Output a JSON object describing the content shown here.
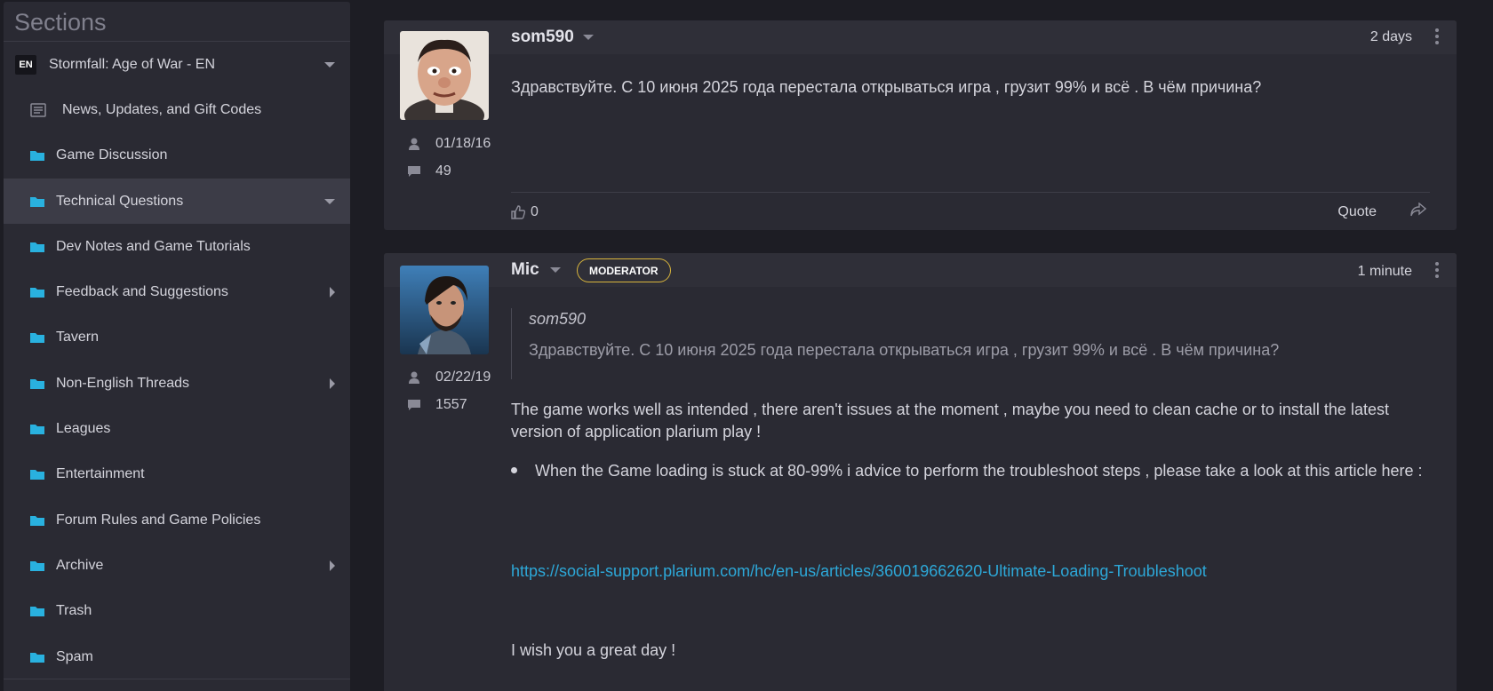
{
  "sidebar": {
    "title": "Sections",
    "root": {
      "badge": "EN",
      "label": "Stormfall: Age of War - EN"
    },
    "items": [
      {
        "label": "News, Updates, and Gift Codes"
      },
      {
        "label": "Game Discussion"
      },
      {
        "label": "Technical Questions"
      },
      {
        "label": "Dev Notes and Game Tutorials"
      },
      {
        "label": "Feedback and Suggestions"
      },
      {
        "label": "Tavern"
      },
      {
        "label": "Non-English Threads"
      },
      {
        "label": "Leagues"
      },
      {
        "label": "Entertainment"
      },
      {
        "label": "Forum Rules and Game Policies"
      },
      {
        "label": "Archive"
      },
      {
        "label": "Trash"
      },
      {
        "label": "Spam"
      }
    ]
  },
  "posts": [
    {
      "username": "som590",
      "time": "2 days",
      "joined": "01/18/16",
      "post_count": "49",
      "text": "Здравствуйте. С 10 июня 2025 года перестала открываться игра , грузит 99% и всё . В чём причина?",
      "likes": "0",
      "quote_label": "Quote"
    },
    {
      "username": "Mic",
      "badge": "MODERATOR",
      "time": "1 minute",
      "joined": "02/22/19",
      "post_count": "1557",
      "quote": {
        "author": "som590",
        "text": "Здравствуйте. С 10 июня 2025 года перестала открываться игра , грузит 99% и всё . В чём причина?"
      },
      "paragraph1": "The game works well as intended , there aren't issues at the moment , maybe you need to clean cache or to install the latest version of application plarium play !",
      "bullet": "When the Game loading is stuck at 80-99%  i advice to perform the troubleshoot steps , please take a look at this article here :",
      "link": "https://social-support.plarium.com/hc/en-us/articles/360019662620-Ultimate-Loading-Troubleshoot",
      "closing": "I wish you a great day !"
    }
  ],
  "colors": {
    "accent_link": "#2da8d8",
    "folder": "#29b1df",
    "moderator_border": "#d9b53c"
  }
}
